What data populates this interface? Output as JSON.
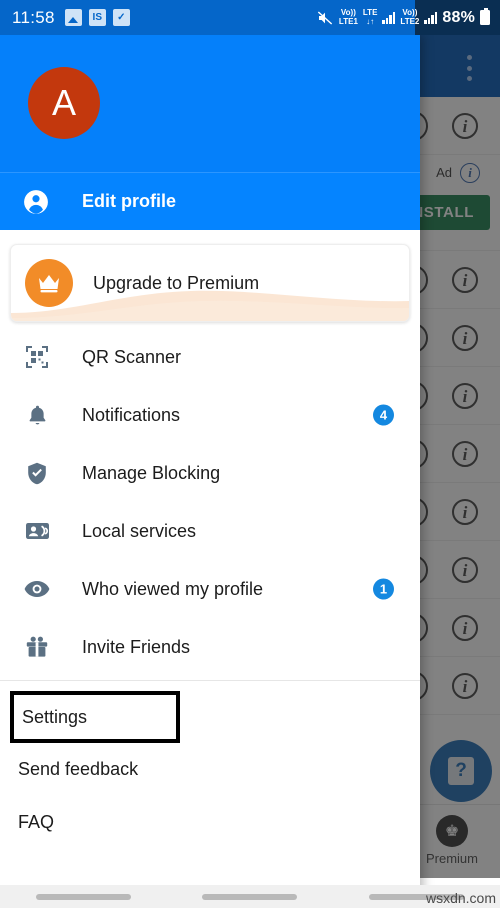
{
  "status_bar": {
    "time": "11:58",
    "left_icons": [
      {
        "name": "photo-icon",
        "label": ""
      },
      {
        "name": "is-app-icon",
        "label": "IS"
      },
      {
        "name": "checkbox-icon",
        "label": "✓"
      }
    ],
    "mute_icon": "mute-icon",
    "sim1_top": "Vo))",
    "sim1_bottom": "LTE1",
    "lte_top": "LTE",
    "lte_bottom": "↓↑",
    "sim2_top": "Vo))",
    "sim2_bottom": "LTE2",
    "battery_percent": "88%"
  },
  "drawer": {
    "avatar_letter": "A",
    "avatar_color": "#C3380D",
    "header_color": "#0580FA",
    "edit_profile_label": "Edit profile",
    "premium_card": {
      "label": "Upgrade to Premium",
      "badge_icon": "crown-icon",
      "badge_color": "#F28C28"
    },
    "menu_items": [
      {
        "label": "QR Scanner",
        "icon": "qr-code-icon",
        "badge": ""
      },
      {
        "label": "Notifications",
        "icon": "bell-icon",
        "badge": "4"
      },
      {
        "label": "Manage Blocking",
        "icon": "shield-check-icon",
        "badge": ""
      },
      {
        "label": "Local services",
        "icon": "contact-card-icon",
        "badge": ""
      },
      {
        "label": "Who viewed my profile",
        "icon": "eye-icon",
        "badge": "1"
      },
      {
        "label": "Invite Friends",
        "icon": "gift-icon",
        "badge": ""
      }
    ],
    "badge_color": "#1488E0",
    "footer_items": [
      {
        "label": "Settings",
        "highlighted": true
      },
      {
        "label": "Send feedback",
        "highlighted": false
      },
      {
        "label": "FAQ",
        "highlighted": false
      }
    ]
  },
  "background_app": {
    "overflow_icon": "overflow-menu-icon",
    "ad_label": "Ad",
    "ad_info_icon": "info-icon",
    "install_button": "INSTALL",
    "help_fab_icon": "question-mark-icon",
    "bottom_nav_premium_label": "Premium",
    "bottom_nav_premium_icon": "crown-icon",
    "row_info_icon": "info-icon"
  },
  "nav_bar": {
    "pills": [
      "recents-pill",
      "home-pill",
      "back-pill"
    ]
  },
  "watermark": "wsxdn.com"
}
